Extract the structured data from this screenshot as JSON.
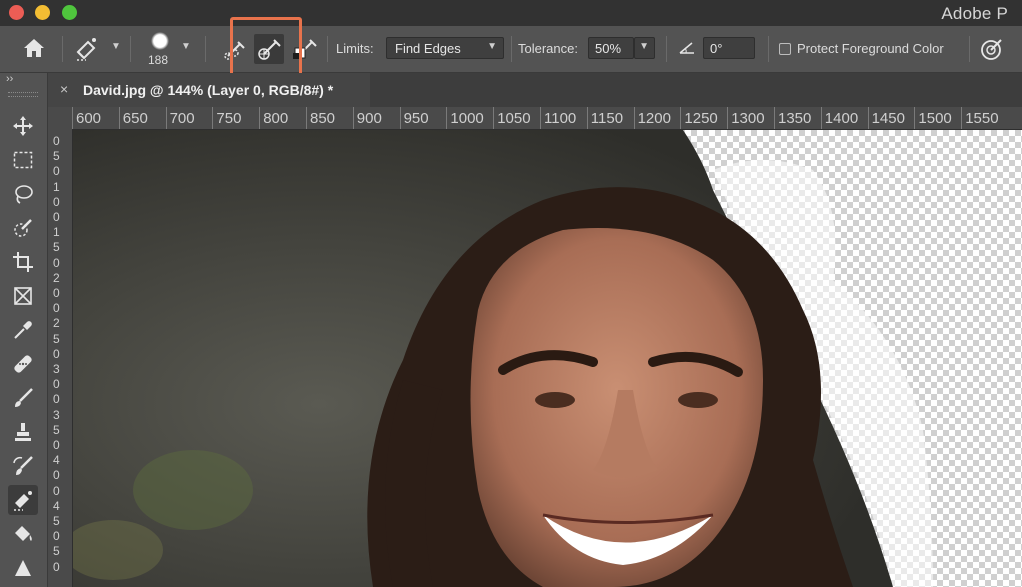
{
  "window": {
    "app_title": "Adobe P"
  },
  "options_bar": {
    "brush_size": "188",
    "limits_label": "Limits:",
    "limits_value": "Find Edges",
    "tolerance_label": "Tolerance:",
    "tolerance_value": "50%",
    "angle_value": "0°",
    "protect_label": "Protect Foreground Color"
  },
  "tab": {
    "close": "×",
    "title": "David.jpg @ 144% (Layer 0, RGB/8#) *"
  },
  "ruler": {
    "h_ticks": [
      "600",
      "650",
      "700",
      "750",
      "800",
      "850",
      "900",
      "950",
      "1000",
      "1050",
      "1100",
      "1150",
      "1200",
      "1250",
      "1300",
      "1350",
      "1400",
      "1450",
      "1500",
      "1550"
    ],
    "v_digits": [
      "0",
      "5",
      "0",
      "1",
      "0",
      "0",
      "1",
      "5",
      "0",
      "2",
      "0",
      "0",
      "2",
      "5",
      "0",
      "3",
      "0",
      "0",
      "3",
      "5",
      "0",
      "4",
      "0",
      "0",
      "4",
      "5",
      "0",
      "5",
      "0"
    ]
  },
  "colors": {
    "highlight": "#e8734c",
    "panel": "#535353",
    "tab_bg": "#454545"
  }
}
